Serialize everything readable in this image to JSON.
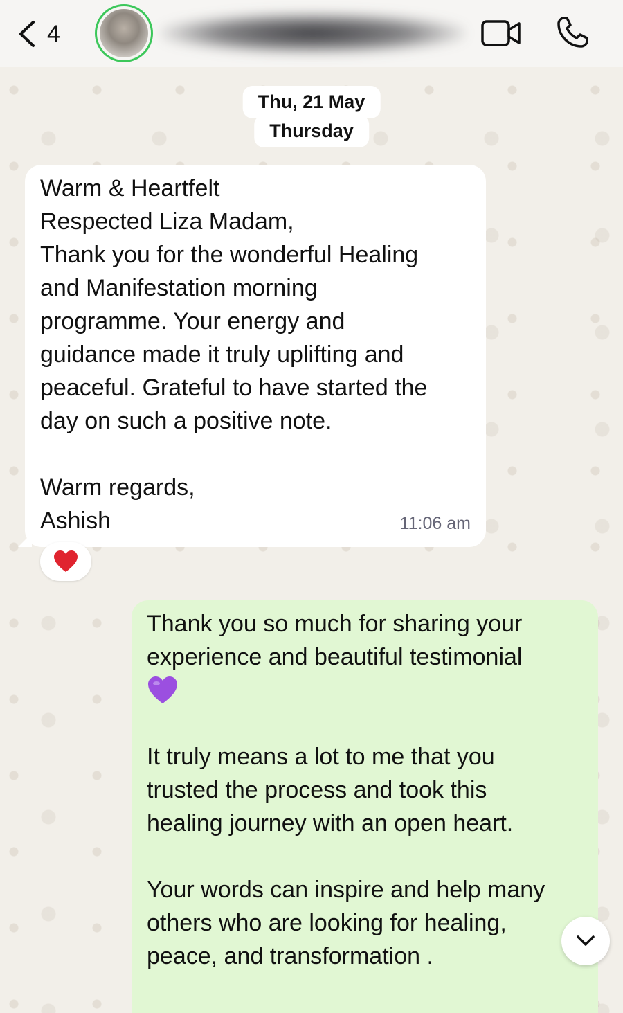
{
  "header": {
    "back_count": "4",
    "contact_name": "",
    "back_icon": "chevron-left-icon",
    "video_icon": "video-camera-icon",
    "call_icon": "phone-icon"
  },
  "date_separator": {
    "date": "Thu, 21 May",
    "day": "Thursday"
  },
  "messages": {
    "incoming": {
      "lines": [
        "Warm & Heartfelt",
        "Respected Liza Madam,",
        "Thank you for the wonderful Healing",
        "and Manifestation morning",
        "programme. Your energy and",
        "guidance made it truly uplifting and",
        "peaceful. Grateful to have started the",
        "day on such a positive note.",
        "",
        "Warm regards,",
        "Ashish"
      ],
      "time": "11:06 am",
      "reaction": "red-heart"
    },
    "outgoing": {
      "lines": [
        "Thank you so much for sharing your",
        "experience and beautiful testimonial",
        "",
        "It truly means a lot to me that you",
        "trusted the process and took this",
        "healing journey with an open heart.",
        "",
        "Your words can inspire and help many",
        "others who are looking for healing,",
        "peace, and transformation ."
      ],
      "emoji": "purple-heart"
    }
  },
  "colors": {
    "incoming_bubble": "#ffffff",
    "outgoing_bubble": "#e1f7d3",
    "avatar_ring": "#3cc75a",
    "reaction_heart": "#e0242f",
    "purple_heart": "#9b4fe0"
  }
}
